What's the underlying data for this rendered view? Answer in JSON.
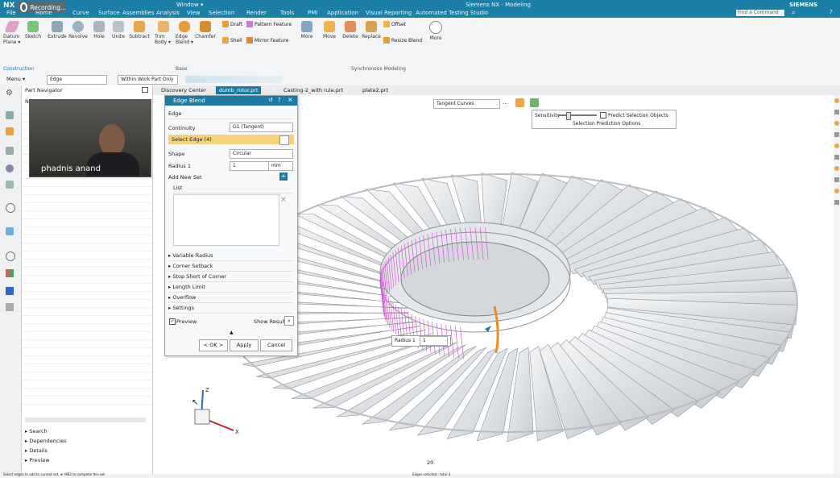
{
  "colors": {
    "title_bg": "#1b7fa6",
    "accent": "#1c7aa3",
    "selected_step": "#f5d27a",
    "edge_highlight": "#d65ad6"
  },
  "titlebar": {
    "app_logo": "NX",
    "recording": "Recording...",
    "window_menu": "Window ▾",
    "window_title": "Siemens NX - Modeling",
    "brand": "SIEMENS",
    "search_placeholder": "Find a Command",
    "menu_tabs": [
      "File",
      "Home",
      "Curve",
      "Surface",
      "Assemblies",
      "Analysis",
      "View",
      "Selection",
      "Render",
      "Tools",
      "PMI",
      "Application",
      "Visual Reporting",
      "Automated Testing Studio"
    ]
  },
  "ribbon": {
    "construction": {
      "group_label": "Construction",
      "items": [
        "Datum Plane ▾",
        "Sketch"
      ]
    },
    "base": {
      "group_label": "Base",
      "items": [
        "Extrude",
        "Revolve",
        "Hole",
        "Unite",
        "Subtract",
        "Trim Body ▾",
        "Edge Blend ▾",
        "Chamfer"
      ]
    },
    "feature_small": [
      "Draft",
      "Pattern Feature",
      "Shell",
      "Mirror Feature"
    ],
    "more_label": "More",
    "sync": {
      "group_label": "Synchronous Modeling",
      "items": [
        "Move",
        "Delete",
        "Replace",
        "Resize Blend"
      ],
      "small": [
        "Offset"
      ]
    },
    "more2": "More"
  },
  "selection_bar": {
    "menu": "Menu ▾",
    "filter": "Edge",
    "scope": "Within Work Part Only"
  },
  "doc_tabs": [
    "Discovery Center",
    "dumb_rotor.prt",
    "Casting-2_with rule.prt",
    "plate2.prt"
  ],
  "navigator": {
    "title": "Part Navigator",
    "column": "Nam",
    "bottom_sections": [
      "Search",
      "Dependencies",
      "Details",
      "Preview"
    ]
  },
  "webcam": {
    "name": "phadnis anand"
  },
  "dialog": {
    "title": "Edge Blend",
    "section_edge": "Edge",
    "continuity_label": "Continuity",
    "continuity_value": "G1 (Tangent)",
    "select_edge": "Select Edge (4)",
    "shape_label": "Shape",
    "shape_value": "Circular",
    "radius_label": "Radius 1",
    "radius_value": "1",
    "radius_unit": "mm",
    "add_new_set": "Add New Set",
    "list_label": "List",
    "collapsed_sections": [
      "Variable Radius",
      "Corner Setback",
      "Stop Short of Corner",
      "Length Limit",
      "Overflow",
      "Settings"
    ],
    "preview_label": "Preview",
    "show_result": "Show Result",
    "ok": "< OK >",
    "apply": "Apply",
    "cancel": "Cancel"
  },
  "viewport": {
    "curve_rule": "Tangent Curves",
    "sensitivity_label": "Sensitivity",
    "predict_label": "Predict Selection Objects",
    "prediction_options": "Selection Prediction Options",
    "radius_callout_label": "Radius 1",
    "radius_callout_value": "1",
    "axis_z": "Z",
    "axis_x": "X",
    "scale_label": "20"
  },
  "statusbar": {
    "left": "Select edges to add to current set, or MB3 to complete this set",
    "center": "Edges selected - total 4"
  }
}
